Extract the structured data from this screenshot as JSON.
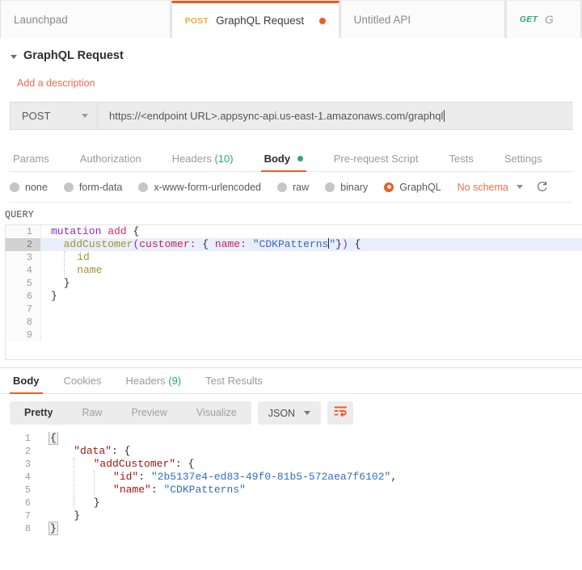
{
  "tabbar": {
    "tabs": [
      {
        "label": "Launchpad",
        "method": "",
        "active": false,
        "unsaved": false
      },
      {
        "label": "GraphQL Request",
        "method": "POST",
        "active": true,
        "unsaved": true
      },
      {
        "label": "Untitled API",
        "method": "",
        "active": false,
        "unsaved": false
      },
      {
        "label": "G",
        "method": "GET",
        "active": false,
        "unsaved": false
      }
    ]
  },
  "request": {
    "title": "GraphQL Request",
    "add_description": "Add a description",
    "method": "POST",
    "url": "https://<endpoint URL>.appsync-api.us-east-1.amazonaws.com/graphql",
    "subtabs": [
      {
        "label": "Params",
        "count": "",
        "active": false,
        "dot": false
      },
      {
        "label": "Authorization",
        "count": "",
        "active": false,
        "dot": false
      },
      {
        "label": "Headers",
        "count": "(10)",
        "active": false,
        "dot": false
      },
      {
        "label": "Body",
        "count": "",
        "active": true,
        "dot": true
      },
      {
        "label": "Pre-request Script",
        "count": "",
        "active": false,
        "dot": false
      },
      {
        "label": "Tests",
        "count": "",
        "active": false,
        "dot": false
      },
      {
        "label": "Settings",
        "count": "",
        "active": false,
        "dot": false
      }
    ],
    "body_types": [
      {
        "label": "none",
        "checked": false
      },
      {
        "label": "form-data",
        "checked": false
      },
      {
        "label": "x-www-form-urlencoded",
        "checked": false
      },
      {
        "label": "raw",
        "checked": false
      },
      {
        "label": "binary",
        "checked": false
      },
      {
        "label": "GraphQL",
        "checked": true
      }
    ],
    "schema_label": "No schema",
    "refresh_icon": "refresh-icon",
    "query_label": "QUERY",
    "query_lines": [
      {
        "n": "1",
        "text": "mutation add {"
      },
      {
        "n": "2",
        "text": "  addCustomer(customer: { name: \"CDKPatterns\"}) {"
      },
      {
        "n": "3",
        "text": "    id"
      },
      {
        "n": "4",
        "text": "    name"
      },
      {
        "n": "5",
        "text": "  }"
      },
      {
        "n": "6",
        "text": "}"
      },
      {
        "n": "7",
        "text": ""
      },
      {
        "n": "8",
        "text": ""
      },
      {
        "n": "9",
        "text": ""
      }
    ]
  },
  "response": {
    "tabs": [
      {
        "label": "Body",
        "count": "",
        "active": true
      },
      {
        "label": "Cookies",
        "count": "",
        "active": false
      },
      {
        "label": "Headers",
        "count": "(9)",
        "active": false
      },
      {
        "label": "Test Results",
        "count": "",
        "active": false
      }
    ],
    "view_modes": [
      {
        "label": "Pretty",
        "active": true
      },
      {
        "label": "Raw",
        "active": false
      },
      {
        "label": "Preview",
        "active": false
      },
      {
        "label": "Visualize",
        "active": false
      }
    ],
    "format": "JSON",
    "wrap_icon": "wrap-text-icon",
    "body_lines": [
      {
        "n": "1",
        "text": "{"
      },
      {
        "n": "2",
        "text": "    \"data\": {"
      },
      {
        "n": "3",
        "text": "        \"addCustomer\": {"
      },
      {
        "n": "4",
        "text": "            \"id\": \"2b5137e4-ed83-49f0-81b5-572aea7f6102\","
      },
      {
        "n": "5",
        "text": "            \"name\": \"CDKPatterns\""
      },
      {
        "n": "6",
        "text": "        }"
      },
      {
        "n": "7",
        "text": "    }"
      },
      {
        "n": "8",
        "text": "}"
      }
    ],
    "values": {
      "data_key": "data",
      "add_customer_key": "addCustomer",
      "id_key": "id",
      "id_value": "2b5137e4-ed83-49f0-81b5-572aea7f6102",
      "name_key": "name",
      "name_value": "CDKPatterns"
    }
  },
  "colors": {
    "accent": "#ef5b25",
    "link": "#ee6c4d",
    "green": "#2aa871",
    "post": "#f0a83c",
    "get": "#2aa871",
    "highlight_row": "#e8eefc"
  }
}
